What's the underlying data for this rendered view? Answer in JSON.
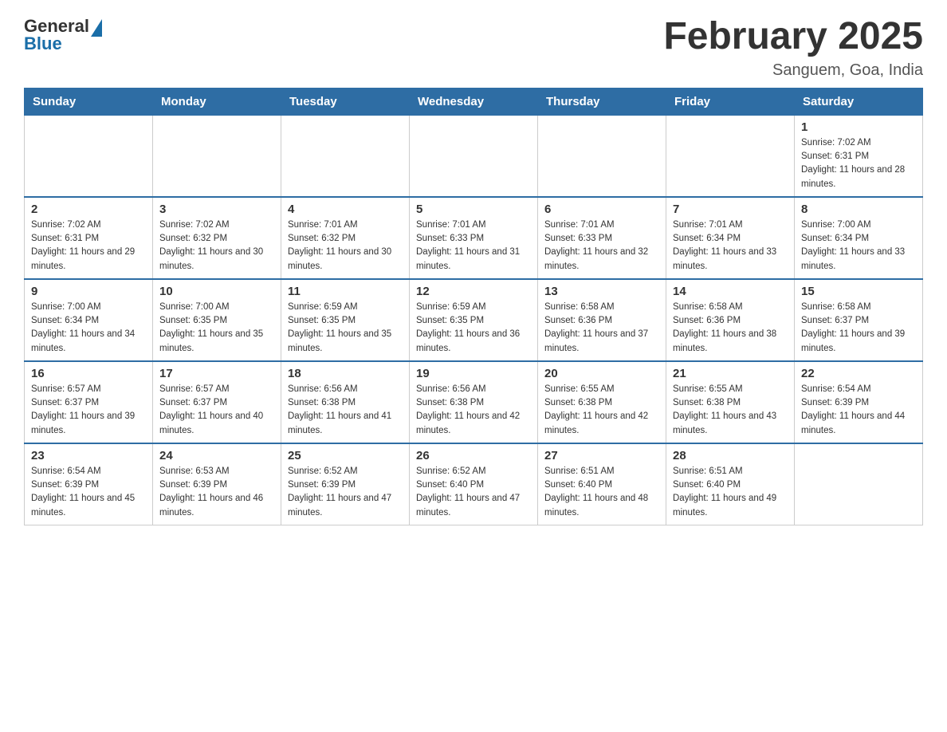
{
  "header": {
    "logo_general": "General",
    "logo_blue": "Blue",
    "title": "February 2025",
    "subtitle": "Sanguem, Goa, India"
  },
  "days_of_week": [
    "Sunday",
    "Monday",
    "Tuesday",
    "Wednesday",
    "Thursday",
    "Friday",
    "Saturday"
  ],
  "weeks": [
    [
      {
        "day": "",
        "info": ""
      },
      {
        "day": "",
        "info": ""
      },
      {
        "day": "",
        "info": ""
      },
      {
        "day": "",
        "info": ""
      },
      {
        "day": "",
        "info": ""
      },
      {
        "day": "",
        "info": ""
      },
      {
        "day": "1",
        "info": "Sunrise: 7:02 AM\nSunset: 6:31 PM\nDaylight: 11 hours and 28 minutes."
      }
    ],
    [
      {
        "day": "2",
        "info": "Sunrise: 7:02 AM\nSunset: 6:31 PM\nDaylight: 11 hours and 29 minutes."
      },
      {
        "day": "3",
        "info": "Sunrise: 7:02 AM\nSunset: 6:32 PM\nDaylight: 11 hours and 30 minutes."
      },
      {
        "day": "4",
        "info": "Sunrise: 7:01 AM\nSunset: 6:32 PM\nDaylight: 11 hours and 30 minutes."
      },
      {
        "day": "5",
        "info": "Sunrise: 7:01 AM\nSunset: 6:33 PM\nDaylight: 11 hours and 31 minutes."
      },
      {
        "day": "6",
        "info": "Sunrise: 7:01 AM\nSunset: 6:33 PM\nDaylight: 11 hours and 32 minutes."
      },
      {
        "day": "7",
        "info": "Sunrise: 7:01 AM\nSunset: 6:34 PM\nDaylight: 11 hours and 33 minutes."
      },
      {
        "day": "8",
        "info": "Sunrise: 7:00 AM\nSunset: 6:34 PM\nDaylight: 11 hours and 33 minutes."
      }
    ],
    [
      {
        "day": "9",
        "info": "Sunrise: 7:00 AM\nSunset: 6:34 PM\nDaylight: 11 hours and 34 minutes."
      },
      {
        "day": "10",
        "info": "Sunrise: 7:00 AM\nSunset: 6:35 PM\nDaylight: 11 hours and 35 minutes."
      },
      {
        "day": "11",
        "info": "Sunrise: 6:59 AM\nSunset: 6:35 PM\nDaylight: 11 hours and 35 minutes."
      },
      {
        "day": "12",
        "info": "Sunrise: 6:59 AM\nSunset: 6:35 PM\nDaylight: 11 hours and 36 minutes."
      },
      {
        "day": "13",
        "info": "Sunrise: 6:58 AM\nSunset: 6:36 PM\nDaylight: 11 hours and 37 minutes."
      },
      {
        "day": "14",
        "info": "Sunrise: 6:58 AM\nSunset: 6:36 PM\nDaylight: 11 hours and 38 minutes."
      },
      {
        "day": "15",
        "info": "Sunrise: 6:58 AM\nSunset: 6:37 PM\nDaylight: 11 hours and 39 minutes."
      }
    ],
    [
      {
        "day": "16",
        "info": "Sunrise: 6:57 AM\nSunset: 6:37 PM\nDaylight: 11 hours and 39 minutes."
      },
      {
        "day": "17",
        "info": "Sunrise: 6:57 AM\nSunset: 6:37 PM\nDaylight: 11 hours and 40 minutes."
      },
      {
        "day": "18",
        "info": "Sunrise: 6:56 AM\nSunset: 6:38 PM\nDaylight: 11 hours and 41 minutes."
      },
      {
        "day": "19",
        "info": "Sunrise: 6:56 AM\nSunset: 6:38 PM\nDaylight: 11 hours and 42 minutes."
      },
      {
        "day": "20",
        "info": "Sunrise: 6:55 AM\nSunset: 6:38 PM\nDaylight: 11 hours and 42 minutes."
      },
      {
        "day": "21",
        "info": "Sunrise: 6:55 AM\nSunset: 6:38 PM\nDaylight: 11 hours and 43 minutes."
      },
      {
        "day": "22",
        "info": "Sunrise: 6:54 AM\nSunset: 6:39 PM\nDaylight: 11 hours and 44 minutes."
      }
    ],
    [
      {
        "day": "23",
        "info": "Sunrise: 6:54 AM\nSunset: 6:39 PM\nDaylight: 11 hours and 45 minutes."
      },
      {
        "day": "24",
        "info": "Sunrise: 6:53 AM\nSunset: 6:39 PM\nDaylight: 11 hours and 46 minutes."
      },
      {
        "day": "25",
        "info": "Sunrise: 6:52 AM\nSunset: 6:39 PM\nDaylight: 11 hours and 47 minutes."
      },
      {
        "day": "26",
        "info": "Sunrise: 6:52 AM\nSunset: 6:40 PM\nDaylight: 11 hours and 47 minutes."
      },
      {
        "day": "27",
        "info": "Sunrise: 6:51 AM\nSunset: 6:40 PM\nDaylight: 11 hours and 48 minutes."
      },
      {
        "day": "28",
        "info": "Sunrise: 6:51 AM\nSunset: 6:40 PM\nDaylight: 11 hours and 49 minutes."
      },
      {
        "day": "",
        "info": ""
      }
    ]
  ]
}
